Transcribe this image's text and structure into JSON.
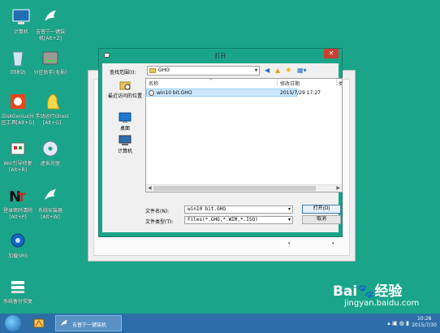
{
  "desktop": {
    "icons": [
      {
        "label": "计算机",
        "icon": "computer-icon"
      },
      {
        "label": "吉普宁一键装\n机[Alt+Z]",
        "icon": "bird-icon"
      },
      {
        "label": "回收站",
        "icon": "recycle-bin-icon"
      },
      {
        "label": "分区助手(无损)",
        "icon": "disk-icon"
      },
      {
        "label": "DiskGenius分区工具[Alt+D]",
        "icon": "diskgenius-icon"
      },
      {
        "label": "手动运行Ghost\n[Alt+G]",
        "icon": "ghost-icon"
      },
      {
        "label": "Win引导修复\n[Alt+R]",
        "icon": "repair-icon"
      },
      {
        "label": "虚拟光驱",
        "icon": "cd-icon"
      },
      {
        "label": "登录密码清除\n[Alt+P]",
        "icon": "password-icon"
      },
      {
        "label": "系统安装器\n[Alt+W]",
        "icon": "install-icon"
      },
      {
        "label": "加载SRS",
        "icon": "srs-icon"
      },
      {
        "label": "系统备份恢复",
        "icon": "backup-icon"
      }
    ]
  },
  "dialog": {
    "title": "打开",
    "close_symbol": "✕",
    "lookin_label": "查找范围(I):",
    "lookin_value": "GHO",
    "places": [
      {
        "label": "最近访问的位置",
        "icon": "recent-places-icon"
      },
      {
        "label": "桌面",
        "icon": "desktop-icon"
      },
      {
        "label": "计算机",
        "icon": "computer-icon"
      }
    ],
    "columns": {
      "name": "名称",
      "date": "修改日期",
      "more": "类"
    },
    "files": [
      {
        "name": "win10 bit.GHO",
        "date": "2015/7/29 17:27"
      }
    ],
    "filename_label": "文件名(N):",
    "filename_value": "win10 bit.GHO",
    "filetype_label": "文件类型(T):",
    "filetype_value": "Files(*.GHO,*.WIM,*.ISO)",
    "open_button": "打开(O)",
    "cancel_button": "取消"
  },
  "taskbar": {
    "task_label": "吉普宁一键装机",
    "time": "10:28",
    "date": "2015/7/30"
  },
  "watermark": {
    "logo": "Bai",
    "logo_suffix": "经验",
    "url": "jingyan.baidu.com"
  },
  "colors": {
    "desktop": "#1aa58a",
    "taskbar": "#2d6ea8",
    "selection": "#cce8ff",
    "close": "#c84031"
  }
}
